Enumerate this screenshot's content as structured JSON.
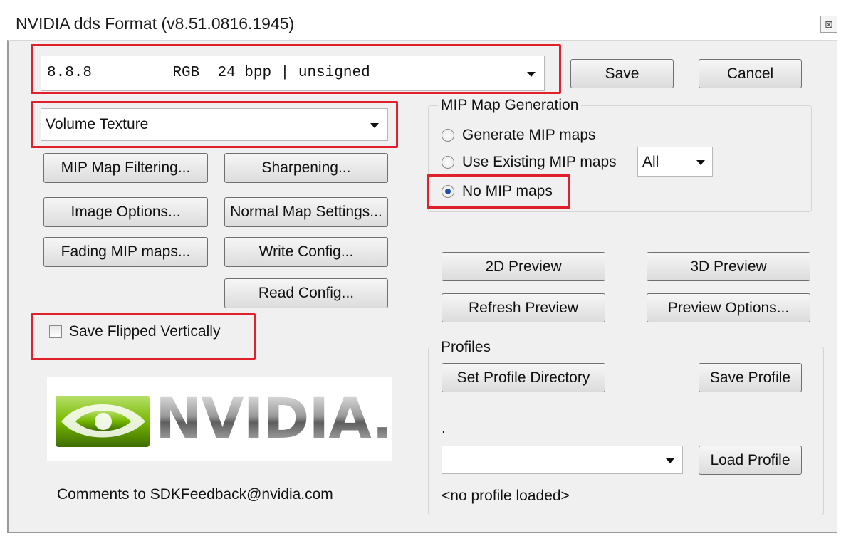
{
  "window": {
    "title": "NVIDIA dds Format (v8.51.0816.1945)",
    "close_glyph": "⊠"
  },
  "format_combo": {
    "value": "8.8.8         RGB  24 bpp | unsigned"
  },
  "texture_combo": {
    "value": "Volume Texture"
  },
  "buttons": {
    "save": "Save",
    "cancel": "Cancel",
    "mip_filtering": "MIP Map Filtering...",
    "sharpening": "Sharpening...",
    "image_options": "Image Options...",
    "normal_map": "Normal Map Settings...",
    "fading_mip": "Fading MIP maps...",
    "write_config": "Write Config...",
    "read_config": "Read Config...",
    "preview_2d": "2D Preview",
    "preview_3d": "3D Preview",
    "refresh_preview": "Refresh Preview",
    "preview_options": "Preview Options...",
    "set_profile_dir": "Set Profile Directory",
    "save_profile": "Save Profile",
    "load_profile": "Load Profile"
  },
  "mip_group": {
    "label": "MIP Map Generation",
    "options": [
      "Generate MIP maps",
      "Use Existing MIP maps",
      "No MIP maps"
    ],
    "selected": "No MIP maps",
    "existing_combo": "All"
  },
  "flip_checkbox": {
    "label": "Save Flipped Vertically",
    "checked": false
  },
  "logo": {
    "text": "NVIDIA."
  },
  "comments": "Comments to SDKFeedback@nvidia.com",
  "profiles": {
    "label": "Profiles",
    "dot": ".",
    "combo_value": "",
    "status": "<no profile loaded>"
  },
  "colors": {
    "highlight": "#e0202a",
    "nvidia_green": "#76b900"
  }
}
